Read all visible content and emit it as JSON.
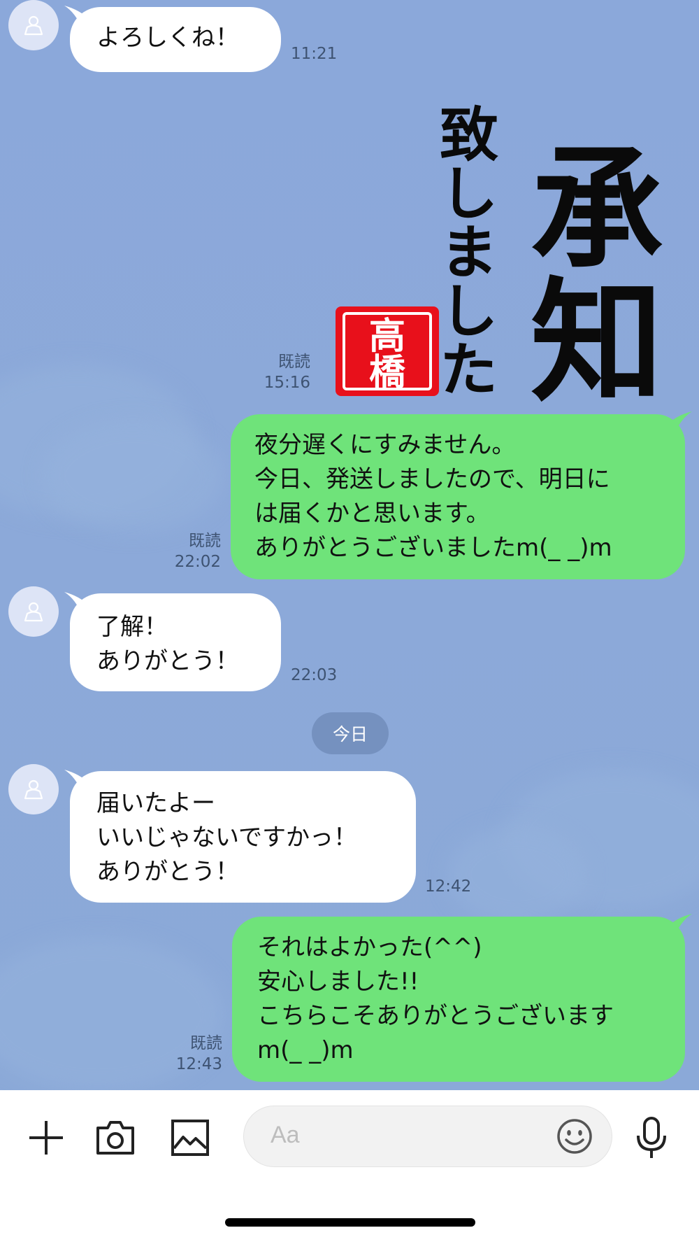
{
  "messages": [
    {
      "type": "incoming",
      "lines": [
        "よろしくね！"
      ],
      "time": "11:21"
    },
    {
      "type": "outgoing_sticker",
      "sticker_text": [
        "承知",
        "致しました"
      ],
      "stamp_text": [
        "高",
        "橋"
      ],
      "read": "既読",
      "time": "15:16"
    },
    {
      "type": "outgoing",
      "lines": [
        "夜分遅くにすみません。",
        "今日、発送しましたので、明日に",
        "は届くかと思います。",
        "ありがとうございましたm(_ _)m"
      ],
      "read": "既読",
      "time": "22:02"
    },
    {
      "type": "incoming",
      "lines": [
        "了解！",
        "ありがとう！"
      ],
      "time": "22:03"
    },
    {
      "type": "incoming",
      "lines": [
        "届いたよー",
        "いいじゃないですかっ！",
        "ありがとう！"
      ],
      "time": "12:42"
    },
    {
      "type": "outgoing",
      "lines": [
        "それはよかった(^^)",
        "安心しました!!",
        "こちらこそありがとうございます",
        "m(_ _)m"
      ],
      "read": "既読",
      "time": "12:43"
    }
  ],
  "date_separator": "今日",
  "input": {
    "placeholder": "Aa"
  },
  "colors": {
    "chat_background": "#8aa8d8",
    "outgoing_bubble": "#6fe37a",
    "incoming_bubble": "#ffffff",
    "stamp_red": "#e8101b"
  },
  "icons": [
    "add-icon",
    "camera-icon",
    "image-icon",
    "emoji-icon",
    "microphone-icon",
    "default-avatar-icon"
  ]
}
